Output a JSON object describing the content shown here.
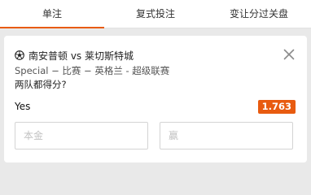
{
  "tabs": [
    {
      "label": "单注",
      "active": true
    },
    {
      "label": "复式投注",
      "active": false
    },
    {
      "label": "变让分过关盘",
      "active": false
    }
  ],
  "bet": {
    "match_title": "南安普顿 vs 莱切斯特城",
    "league": "Special − 比赛 − 英格兰 - 超级联赛",
    "question": "两队都得分?",
    "selection": "Yes",
    "odds": "1.763",
    "stake_placeholder": "本金",
    "win_placeholder": "赢"
  },
  "colors": {
    "accent": "#e85b10",
    "background": "#e9e9e9"
  },
  "icons": {
    "match": "soccer-ball-icon",
    "close": "close-icon"
  }
}
